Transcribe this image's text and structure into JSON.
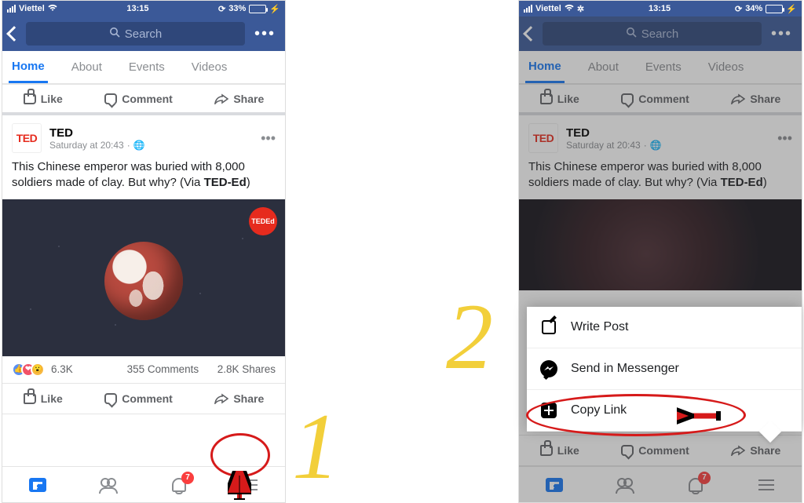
{
  "annotations": {
    "step1": "1",
    "step2": "2"
  },
  "phones": [
    {
      "id": "left",
      "status": {
        "carrier": "Viettel",
        "time": "13:15",
        "battery_pct": "33%",
        "battery_fill": "33%"
      },
      "nav": {
        "search_placeholder": "Search"
      },
      "tabs": {
        "home": "Home",
        "about": "About",
        "events": "Events",
        "videos": "Videos"
      },
      "actions": {
        "like": "Like",
        "comment": "Comment",
        "share": "Share"
      },
      "post": {
        "author": "TED",
        "avatar_text": "TED",
        "timestamp": "Saturday at 20:43",
        "text_a": "This Chinese emperor was buried with 8,000 soldiers made of clay. But why? (Via ",
        "text_bold": "TED-Ed",
        "text_b": ")",
        "badge": "TEDEd"
      },
      "stats": {
        "reactions": "6.3K",
        "comments": "355 Comments",
        "shares": "2.8K Shares"
      },
      "tabbar": {
        "notifications_badge": "7"
      }
    },
    {
      "id": "right",
      "status": {
        "carrier": "Viettel",
        "time": "13:15",
        "battery_pct": "34%",
        "battery_fill": "34%"
      },
      "nav": {
        "search_placeholder": "Search"
      },
      "tabs": {
        "home": "Home",
        "about": "About",
        "events": "Events",
        "videos": "Videos"
      },
      "actions": {
        "like": "Like",
        "comment": "Comment",
        "share": "Share"
      },
      "post": {
        "author": "TED",
        "avatar_text": "TED",
        "timestamp": "Saturday at 20:43",
        "text_a": "This Chinese emperor was buried with 8,000 soldiers made of clay. But why? (Via ",
        "text_bold": "TED-Ed",
        "text_b": ")"
      },
      "sheet": {
        "write_post": "Write Post",
        "send_messenger": "Send in Messenger",
        "copy_link": "Copy Link"
      },
      "tabbar": {
        "notifications_badge": "7"
      }
    }
  ]
}
